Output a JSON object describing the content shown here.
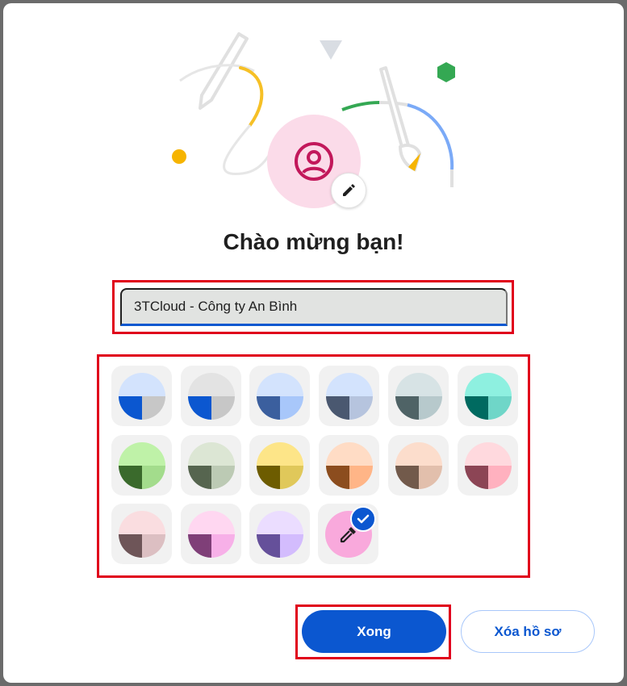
{
  "dialog": {
    "title": "Chào mừng bạn!",
    "profile_name_value": "3TCloud - Công ty An Bình",
    "done_label": "Xong",
    "delete_label": "Xóa hồ sơ"
  },
  "avatar": {
    "icon": "person-icon",
    "edit_icon": "pencil-icon",
    "color": "#c2185b"
  },
  "accent_color": "#0b57d0",
  "colors": [
    {
      "name": "blue",
      "top": "#d3e3fd",
      "left": "#0b57d0",
      "right": "#c7c7c7"
    },
    {
      "name": "grey-blue",
      "top": "#e3e3e3",
      "left": "#0b57d0",
      "right": "#c7c7c7"
    },
    {
      "name": "light-blue",
      "top": "#d3e3fd",
      "left": "#3b5f9e",
      "right": "#a8c7fa"
    },
    {
      "name": "slate",
      "top": "#d3e3fd",
      "left": "#4a5870",
      "right": "#b6c4de"
    },
    {
      "name": "teal-grey",
      "top": "#d7e3e5",
      "left": "#4f6366",
      "right": "#b7c9cc"
    },
    {
      "name": "aqua",
      "top": "#8ef0e0",
      "left": "#006a60",
      "right": "#6fd6c8"
    },
    {
      "name": "green",
      "top": "#bff2a8",
      "left": "#3a6a2c",
      "right": "#a3dc8c"
    },
    {
      "name": "sage",
      "top": "#dce6d4",
      "left": "#56654f",
      "right": "#bccab4"
    },
    {
      "name": "yellow",
      "top": "#fde588",
      "left": "#6d5c00",
      "right": "#e0c85a"
    },
    {
      "name": "orange",
      "top": "#ffdcc5",
      "left": "#8c4d1e",
      "right": "#ffb587"
    },
    {
      "name": "tan",
      "top": "#fcddcc",
      "left": "#725a4b",
      "right": "#e2bfac"
    },
    {
      "name": "rose",
      "top": "#ffd9de",
      "left": "#8c4555",
      "right": "#ffb1bf"
    },
    {
      "name": "blush",
      "top": "#fadde0",
      "left": "#6e5558",
      "right": "#dcbfc2"
    },
    {
      "name": "pink",
      "top": "#ffd7f1",
      "left": "#7f3f78",
      "right": "#f7b0e8"
    },
    {
      "name": "lavender",
      "top": "#ebddff",
      "left": "#65509a",
      "right": "#d3bcfd"
    }
  ],
  "custom_color": {
    "name": "color-picker",
    "color": "#f9a9dc",
    "selected": true
  }
}
